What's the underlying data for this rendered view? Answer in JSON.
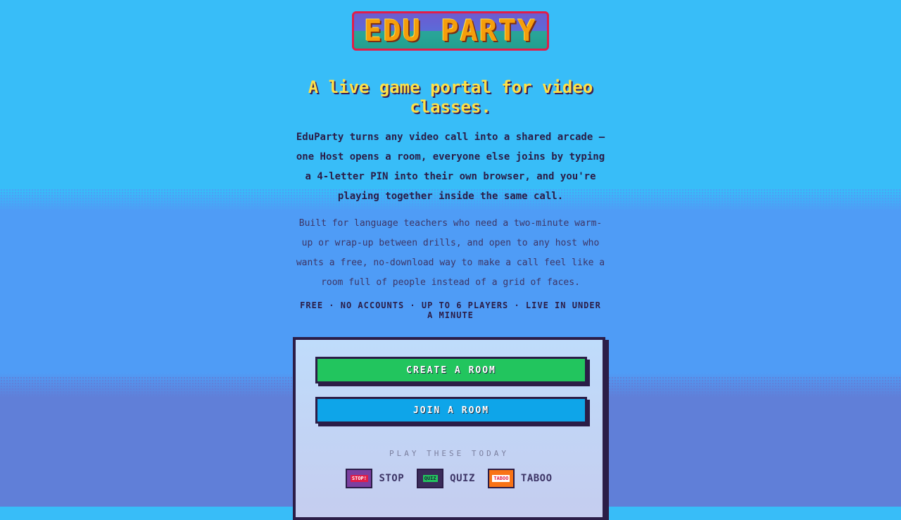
{
  "logo": {
    "text": "EDU PARTY"
  },
  "hero": {
    "headline": "A live game portal for video classes.",
    "intro": "EduParty turns any video call into a shared arcade — one Host opens a room, everyone else joins by typing a 4-letter PIN into their own browser, and you're playing together inside the same call.",
    "built_for": "Built for language teachers who need a two-minute warm-up or wrap-up between drills, and open to any host who wants a free, no-download way to make a call feel like a room full of people instead of a grid of faces.",
    "tagline": "FREE · NO ACCOUNTS · UP TO 6 PLAYERS · LIVE IN UNDER A MINUTE"
  },
  "panel": {
    "create_label": "CREATE A ROOM",
    "join_label": "JOIN A ROOM",
    "play_label": "PLAY THESE TODAY",
    "games": [
      {
        "label": "STOP",
        "thumb_text": "STOP!",
        "icon": "stop-game-icon"
      },
      {
        "label": "QUIZ",
        "thumb_text": "QUIZ",
        "icon": "quiz-game-icon"
      },
      {
        "label": "TABOO",
        "thumb_text": "TABOO",
        "icon": "taboo-game-icon"
      }
    ]
  },
  "colors": {
    "sky": "#38bdf8",
    "create_button": "#22c55e",
    "join_button": "#0ea5e9",
    "headline": "#fde047",
    "logo_border": "#e11d48"
  }
}
